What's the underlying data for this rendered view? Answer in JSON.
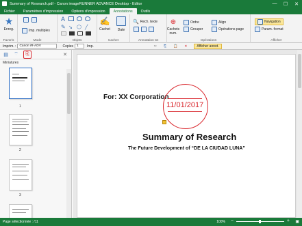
{
  "window": {
    "title": "Summary of Research.pdf - Canon imageRUNNER ADVANCE Desktop - Editor",
    "controls": [
      "—",
      "☐",
      "✕"
    ]
  },
  "tabs": [
    "Fichier",
    "Paramètres d'impression",
    "Options d'impression",
    "Annotations",
    "Outils"
  ],
  "ribbon": {
    "favoris": {
      "button": "Enreg.",
      "label": "Favoris"
    },
    "mode": {
      "button": "Imp. multiples",
      "label": "Mode"
    },
    "objets": {
      "label": "Objets"
    },
    "cachet": {
      "cachet": "Cachet",
      "date": "Date",
      "label": "Cachet"
    },
    "annotation_txt": {
      "rech_texte": "Rech. texte",
      "label": "Annotation txt"
    },
    "operations": {
      "cachets_num": "Cachets num.",
      "ordre": "Ordre",
      "grouper": "Grouper",
      "align": "Align",
      "operations_page": "Opérations page",
      "label": "Opérations"
    },
    "afficher": {
      "navigation": "Navigation",
      "param_format": "Param. format",
      "label": "Afficher"
    }
  },
  "propbar": {
    "imprim_label": "Imprim. :",
    "printer": "Canon iR-ADV",
    "copies_label": "Copies",
    "copies_value": "1",
    "imp_label": "Imp.",
    "afficher_annot": "Afficher annot."
  },
  "sidebar": {
    "heading": "Miniatures",
    "pages": [
      "1",
      "2",
      "3"
    ]
  },
  "document": {
    "for_text": "For: XX Corporation",
    "stamp_date": "11/01/2017",
    "title": "Summary of Research",
    "subtitle": "The Future Development of “DE LA CIUDAD LUNA”"
  },
  "status": {
    "left": "Page sélectionnée : /11",
    "zoom": "100%"
  },
  "colors": {
    "accent": "#1a7a3a",
    "stamp": "#d9262c"
  }
}
